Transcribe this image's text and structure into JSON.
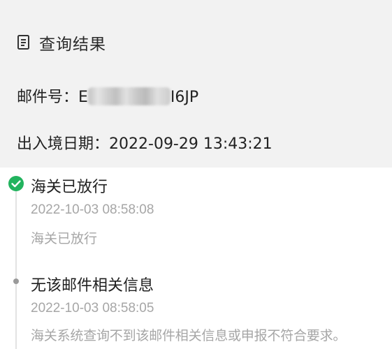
{
  "header": {
    "icon": "document-icon",
    "title": "查询结果"
  },
  "info": {
    "mail_label": "邮件号：",
    "mail_value_visible_prefix": "E",
    "mail_value_visible_suffix": "I6JP",
    "date_label": "出入境日期：",
    "date_value": "2022-09-29 13:43:21"
  },
  "timeline": {
    "events": [
      {
        "status_icon": "check-circle-icon",
        "status_color": "#22b35e",
        "title": "海关已放行",
        "time": "2022-10-03 08:58:08",
        "description": "海关已放行"
      },
      {
        "status_icon": "dot-icon",
        "status_color": "#9a9a9a",
        "title": "无该邮件相关信息",
        "time": "2022-10-03 08:58:05",
        "description": "海关系统查询不到该邮件相关信息或申报不符合要求。"
      }
    ]
  }
}
